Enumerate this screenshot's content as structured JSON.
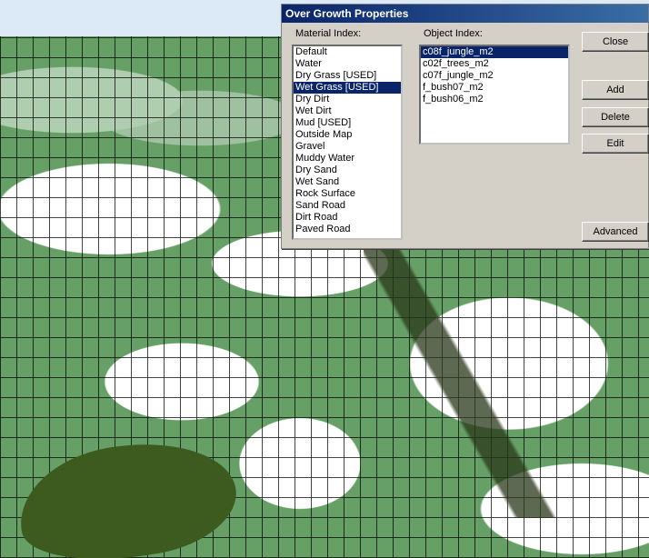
{
  "dialog": {
    "title": "Over Growth Properties",
    "material_label": "Material Index:",
    "object_label": "Object Index:",
    "materials": [
      {
        "label": "Default",
        "selected": false
      },
      {
        "label": "Water",
        "selected": false
      },
      {
        "label": "Dry Grass  [USED]",
        "selected": false
      },
      {
        "label": "Wet Grass  [USED]",
        "selected": true
      },
      {
        "label": "Dry Dirt",
        "selected": false
      },
      {
        "label": "Wet Dirt",
        "selected": false
      },
      {
        "label": "Mud  [USED]",
        "selected": false
      },
      {
        "label": "Outside Map",
        "selected": false
      },
      {
        "label": "Gravel",
        "selected": false
      },
      {
        "label": "Muddy Water",
        "selected": false
      },
      {
        "label": "Dry Sand",
        "selected": false
      },
      {
        "label": "Wet Sand",
        "selected": false
      },
      {
        "label": "Rock Surface",
        "selected": false
      },
      {
        "label": "Sand Road",
        "selected": false
      },
      {
        "label": "Dirt Road",
        "selected": false
      },
      {
        "label": "Paved Road",
        "selected": false
      }
    ],
    "objects": [
      {
        "label": "c08f_jungle_m2",
        "selected": true
      },
      {
        "label": "c02f_trees_m2",
        "selected": false
      },
      {
        "label": "c07f_jungle_m2",
        "selected": false
      },
      {
        "label": "f_bush07_m2",
        "selected": false
      },
      {
        "label": "f_bush06_m2",
        "selected": false
      }
    ],
    "buttons": {
      "close": "Close",
      "add": "Add",
      "delete": "Delete",
      "edit": "Edit",
      "advanced": "Advanced"
    }
  }
}
